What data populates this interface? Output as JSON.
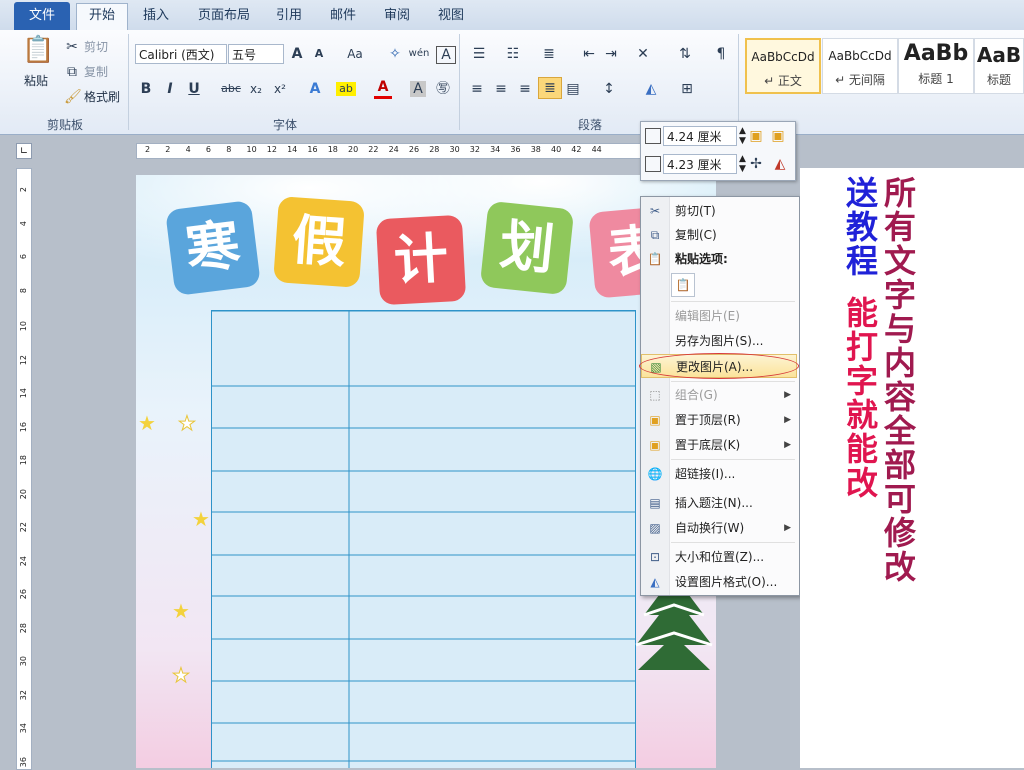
{
  "tabs": [
    "文件",
    "开始",
    "插入",
    "页面布局",
    "引用",
    "邮件",
    "审阅",
    "视图"
  ],
  "clipboard": {
    "paste": "粘贴",
    "cut": "剪切",
    "copy": "复制",
    "format_painter": "格式刷",
    "label": "剪贴板"
  },
  "font": {
    "name": "Calibri (西文)",
    "size": "五号",
    "label": "字体"
  },
  "paragraph": {
    "label": "段落"
  },
  "styles": [
    {
      "preview": "AaBbCcDd",
      "name": "↵ 正文"
    },
    {
      "preview": "AaBbCcDd",
      "name": "↵ 无间隔"
    },
    {
      "preview": "AaBb",
      "name": "标题 1"
    },
    {
      "preview": "AaB",
      "name": "标题"
    }
  ],
  "ruler_ticks": [
    "2",
    "2",
    "4",
    "6",
    "8",
    "10",
    "12",
    "14",
    "16",
    "18",
    "20",
    "22",
    "24",
    "26",
    "28",
    "30",
    "32",
    "34",
    "36",
    "38",
    "40",
    "42",
    "44"
  ],
  "vruler_ticks": [
    "2",
    "4",
    "6",
    "8",
    "10",
    "12",
    "14",
    "16",
    "18",
    "20",
    "22",
    "24",
    "26",
    "28",
    "30",
    "32",
    "34",
    "36"
  ],
  "size_popup": {
    "height": "4.24 厘米",
    "width": "4.23 厘米"
  },
  "title_chars": [
    "寒",
    "假",
    "计",
    "划",
    "表"
  ],
  "context_menu": {
    "cut": "剪切(T)",
    "copy": "复制(C)",
    "paste_options": "粘贴选项:",
    "edit_picture": "编辑图片(E)",
    "save_as_picture": "另存为图片(S)...",
    "change_picture": "更改图片(A)...",
    "group": "组合(G)",
    "bring_front": "置于顶层(R)",
    "send_back": "置于底层(K)",
    "hyperlink": "超链接(I)...",
    "insert_caption": "插入题注(N)...",
    "wrap_text": "自动换行(W)",
    "size_position": "大小和位置(Z)...",
    "format_picture": "设置图片格式(O)..."
  },
  "annotation": {
    "line1": "所有文字与内容全部可修改",
    "line2": "送教程",
    "line3": "能打字就能改"
  }
}
